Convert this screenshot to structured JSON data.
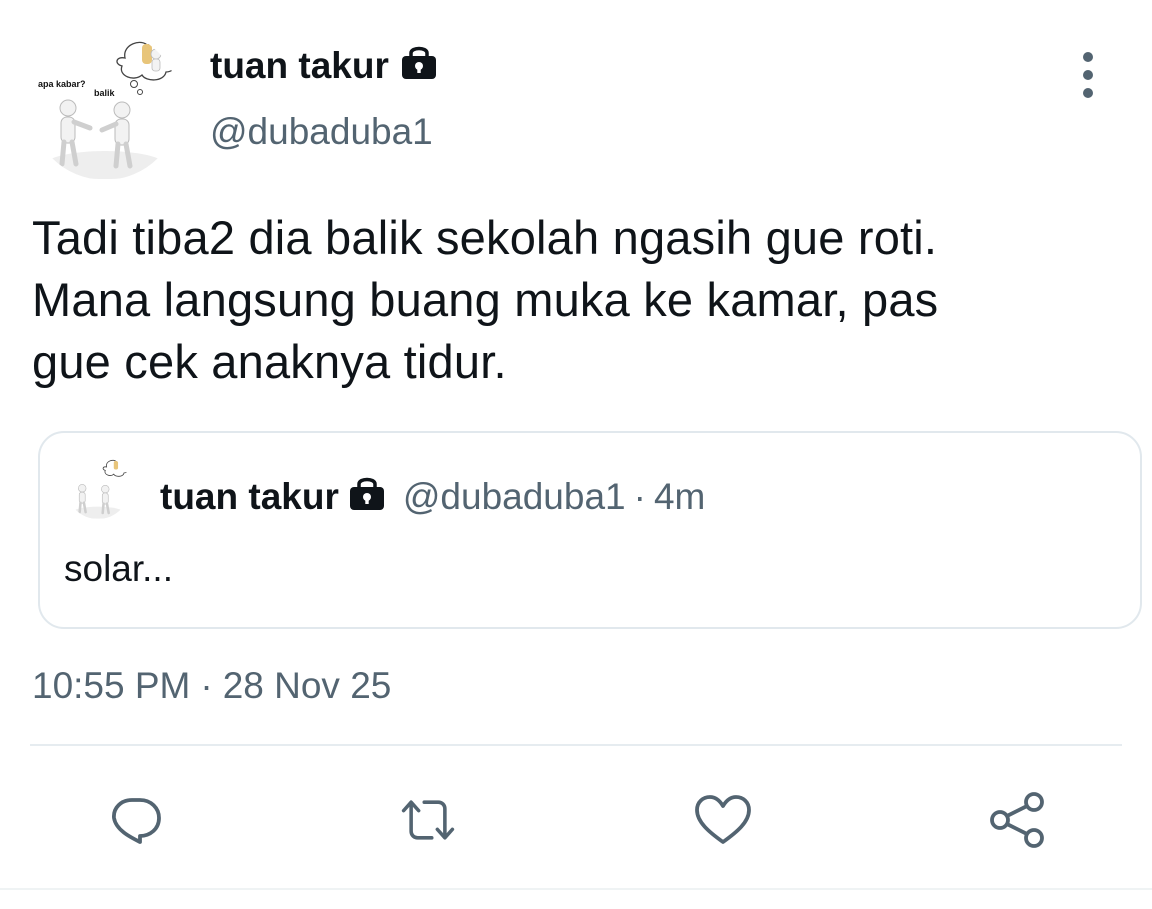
{
  "author": {
    "display_name": "tuan takur",
    "handle": "@dubaduba1",
    "protected": true,
    "avatar_caption_left": "apa kabar?",
    "avatar_caption_right": "balik"
  },
  "tweet": {
    "text_lines": [
      "Tadi tiba2 dia balik sekolah ngasih gue roti.",
      "Mana langsung buang muka ke kamar, pas",
      "gue cek anaknya tidur."
    ],
    "timestamp_time": "10:55 PM",
    "timestamp_separator": "·",
    "timestamp_date": "28 Nov 25"
  },
  "quoted_tweet": {
    "display_name": "tuan takur",
    "handle": "@dubaduba1",
    "separator": "·",
    "relative_time": "4m",
    "text": "solar..."
  },
  "actions": [
    {
      "name": "reply",
      "icon": "reply-icon"
    },
    {
      "name": "retweet",
      "icon": "retweet-icon"
    },
    {
      "name": "like",
      "icon": "heart-icon"
    },
    {
      "name": "share",
      "icon": "share-icon"
    }
  ],
  "colors": {
    "text_primary": "#0f1419",
    "text_secondary": "#536471",
    "icon": "#536471",
    "border": "#e1e8ed"
  }
}
